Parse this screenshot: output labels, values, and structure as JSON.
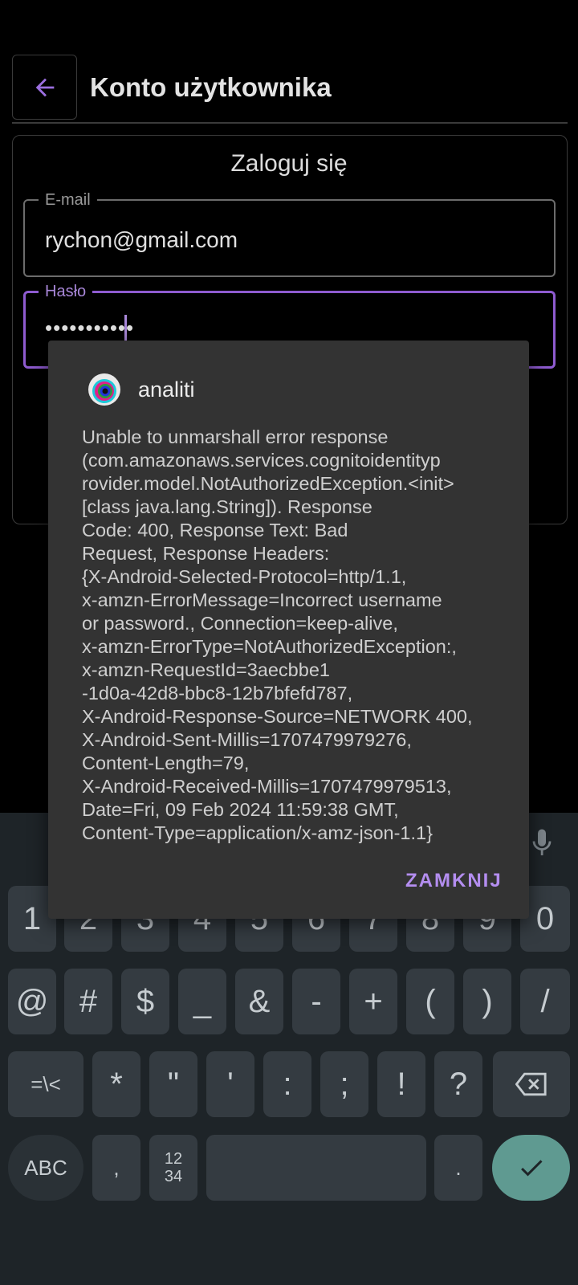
{
  "header": {
    "back_icon": "arrow-left-icon",
    "title": "Konto użytkownika"
  },
  "login": {
    "title": "Zaloguj się",
    "email_label": "E-mail",
    "email_value": "rychon@gmail.com",
    "password_label": "Hasło",
    "password_value": "•••••••••••"
  },
  "dialog": {
    "app_name": "analiti",
    "message": "Unable to unmarshall error response\n(com.amazonaws.services.cognitoidentityp\nrovider.model.NotAuthorizedException.<init>\n[class java.lang.String]). Response\nCode: 400, Response Text: Bad\nRequest, Response Headers:\n{X-Android-Selected-Protocol=http/1.1,\nx-amzn-ErrorMessage=Incorrect username\nor password., Connection=keep-alive,\nx-amzn-ErrorType=NotAuthorizedException:,\nx-amzn-RequestId=3aecbbe1\n-1d0a-42d8-bbc8-12b7bfefd787,\nX-Android-Response-Source=NETWORK 400,\nX-Android-Sent-Millis=1707479979276,\nContent-Length=79,\nX-Android-Received-Millis=1707479979513,\nDate=Fri, 09 Feb 2024 11:59:38 GMT,\nContent-Type=application/x-amz-json-1.1}",
    "close_label": "ZAMKNIJ"
  },
  "keyboard": {
    "row1": [
      "1",
      "2",
      "3",
      "4",
      "5",
      "6",
      "7",
      "8",
      "9",
      "0"
    ],
    "row2": [
      "@",
      "#",
      "$",
      "_",
      "&",
      "-",
      "+",
      "(",
      ")",
      "/"
    ],
    "row3": [
      "=\\<",
      "*",
      "\"",
      "'",
      ":",
      ";",
      "!",
      "?"
    ],
    "abc_label": "ABC",
    "comma_label": ",",
    "numpad_label_top": "12",
    "numpad_label_bottom": "34",
    "period_label": ".",
    "icons": {
      "mic": "mic-icon",
      "backspace": "backspace-icon",
      "enter": "check-icon"
    },
    "colors": {
      "enter_key": "#5f9a91",
      "accent": "#8e5bd0"
    }
  }
}
